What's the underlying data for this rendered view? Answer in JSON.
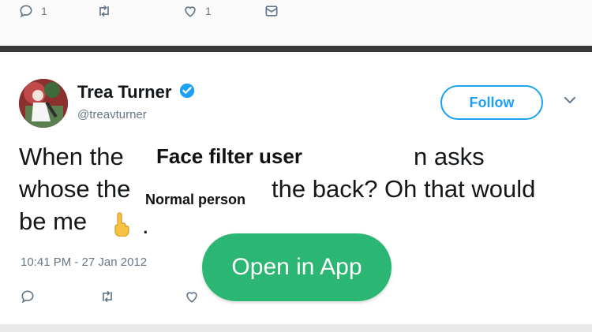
{
  "prev_tweet": {
    "reply_count": "1",
    "like_count": "1"
  },
  "tweet": {
    "display_name": "Trea Turner",
    "handle": "@treavturner",
    "follow_label": "Follow",
    "text_line1_start": "When the",
    "text_line1_end": "n asks",
    "text_line2_start": "whose the",
    "text_line2_end": "the back? Oh that would",
    "text_line3": "be me",
    "period": ".",
    "timestamp": "10:41 PM - 27 Jan 2012"
  },
  "overlays": {
    "face_filter_user": "Face filter user",
    "normal_person": "Normal person",
    "open_in_app": "Open in App"
  },
  "colors": {
    "accent": "#1da1f2",
    "open_in_app_bg": "#2bb673",
    "muted": "#657786"
  },
  "icons": [
    "reply-icon",
    "retweet-icon",
    "heart-icon",
    "mail-icon",
    "verified-icon",
    "chevron-down-icon",
    "pointing-up-emoji-icon"
  ]
}
